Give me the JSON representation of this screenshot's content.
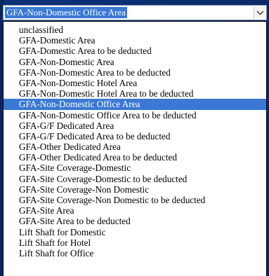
{
  "select": {
    "value": "GFA-Non-Domestic Office Area",
    "arrow_icon": "chevron-down-icon"
  },
  "list": {
    "selected_index": 8,
    "options": [
      "unclassified",
      "GFA-Domestic Area",
      "GFA-Domestic Area to be deducted",
      "GFA-Non-Domestic Area",
      "GFA-Non-Domestic Area to be deducted",
      "GFA-Non-Domestic Hotel Area",
      "GFA-Non-Domestic Hotel Area to be deducted",
      "GFA-Non-Domestic Office Area",
      "GFA-Non-Domestic Office Area to be deducted",
      "GFA-G/F Dedicated Area",
      "GFA-G/F Dedicated Area to be deducted",
      "GFA-Other Dedicated Area",
      "GFA-Other Dedicated Area to be deducted",
      "GFA-Site Coverage-Domestic",
      "GFA-Site Coverage-Domestic to be deducted",
      "GFA-Site Coverage-Non Domestic",
      "GFA-Site Coverage-Non Domestic to be deducted",
      "GFA-Site Area",
      "GFA-Site Area to be deducted",
      "Lift Shaft for Domestic",
      "Lift Shaft for Hotel",
      "Lift Shaft for Office"
    ]
  },
  "colors": {
    "highlight": "#3a78d4",
    "background": "#0a2a6a"
  }
}
